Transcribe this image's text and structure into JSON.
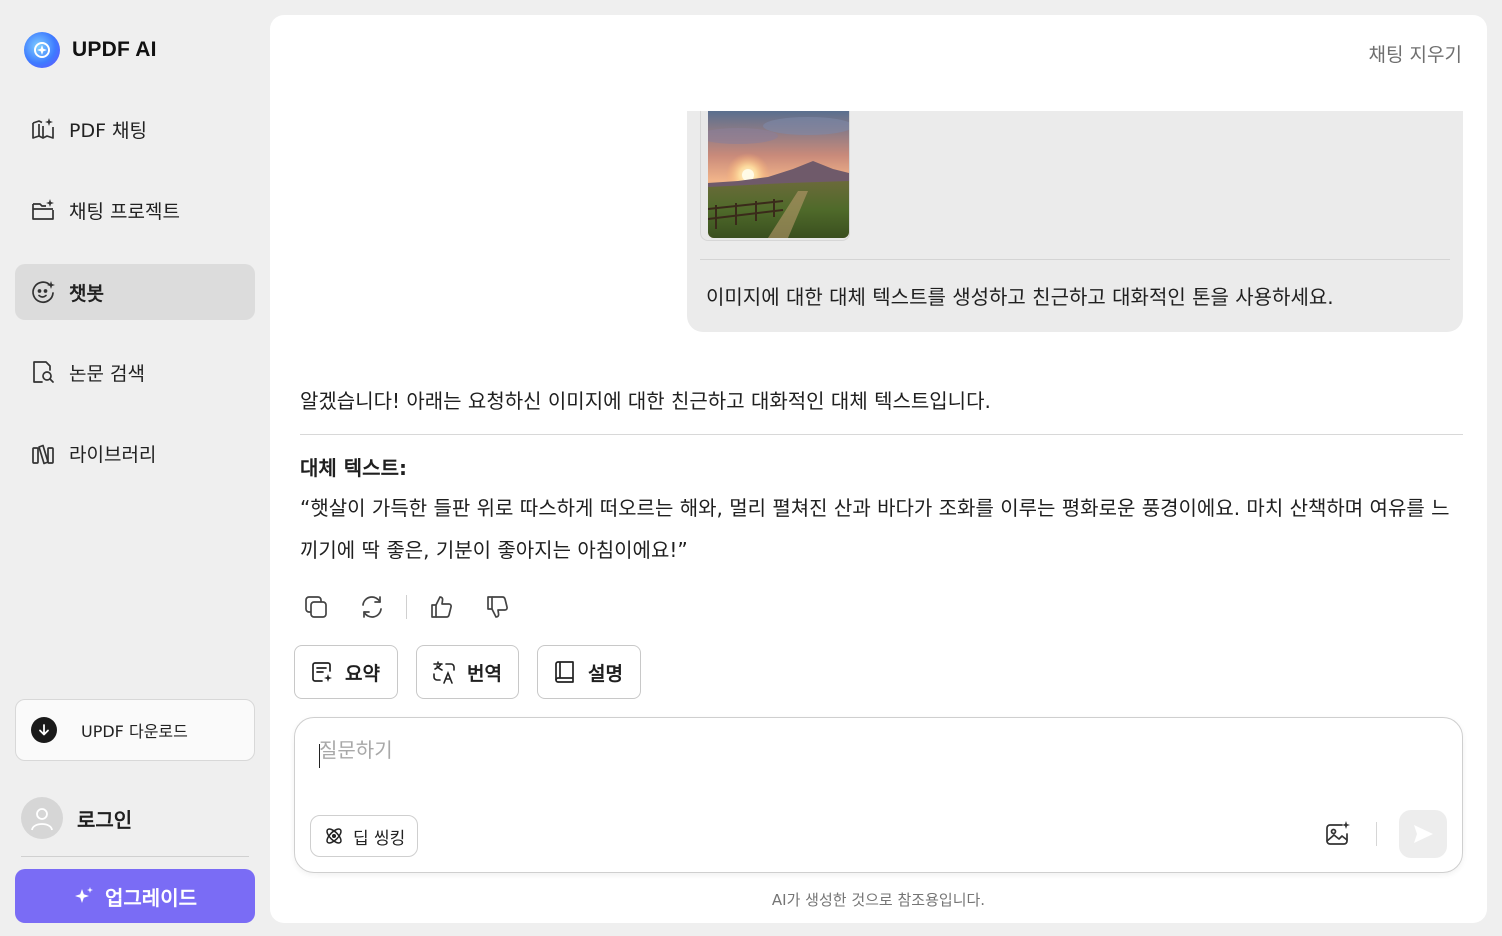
{
  "brand": {
    "title": "UPDF AI"
  },
  "sidebar": {
    "items": [
      {
        "label": "PDF 채팅",
        "icon": "book-sparkle-icon"
      },
      {
        "label": "채팅 프로젝트",
        "icon": "folder-sparkle-icon"
      },
      {
        "label": "챗봇",
        "icon": "bot-face-icon",
        "active": true
      },
      {
        "label": "논문 검색",
        "icon": "doc-search-icon"
      },
      {
        "label": "라이브러리",
        "icon": "library-icon"
      }
    ],
    "download_label": "UPDF 다운로드",
    "login_label": "로그인",
    "upgrade_label": "업그레이드"
  },
  "header": {
    "clear_chat": "채팅 지우기"
  },
  "conversation": {
    "user_message": "이미지에 대한 대체 텍스트를 생성하고 친근하고 대화적인 톤을 사용하세요.",
    "ai_intro": "알겠습니다! 아래는 요청하신 이미지에 대한 친근하고 대화적인 대체 텍스트입니다.",
    "ai_heading": "대체 텍스트:",
    "ai_body": "“햇살이 가득한 들판 위로 따스하게 떠오르는 해와, 멀리 펼쳐진 산과 바다가 조화를 이루는 평화로운 풍경이에요. 마치 산책하며 여유를 느끼기에 딱 좋은, 기분이 좋아지는 아침이에요!”"
  },
  "quick_actions": {
    "summary": "요약",
    "translate": "번역",
    "explain": "설명"
  },
  "composer": {
    "placeholder": "질문하기",
    "deep_thinking": "딥 씽킹"
  },
  "footer": {
    "disclaimer": "AI가 생성한 것으로 참조용입니다."
  },
  "colors": {
    "accent": "#7a6cf5",
    "active_nav": "#dcdcdc",
    "bubble": "#ebebeb"
  }
}
